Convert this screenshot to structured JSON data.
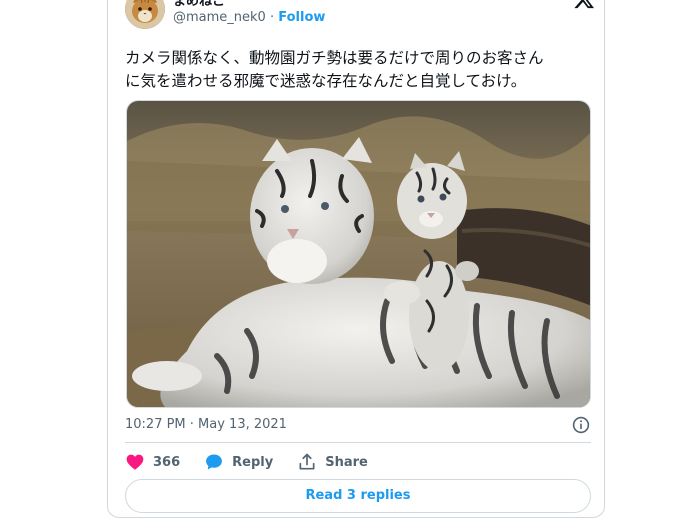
{
  "tweet": {
    "author": {
      "display_name": "まめねこ",
      "handle": "@mame_nek0",
      "separator": "·",
      "follow_label": "Follow",
      "avatar_icon": "cat-avatar"
    },
    "brand_icon": "x-logo-icon",
    "text_lines": [
      "カメラ関係なく、動物園ガチ勢は要るだけで周りのお客さん",
      "に気を遣わせる邪魔で迷惑な存在なんだと自覚しておけ。"
    ],
    "media": {
      "icon": "photo-white-tiger-with-cub"
    },
    "timestamp": "10:27 PM · May 13, 2021",
    "actions": {
      "like_count": "366",
      "reply_label": "Reply",
      "share_label": "Share"
    },
    "read_replies_label": "Read 3 replies",
    "colors": {
      "accent": "#1d9bf0",
      "like": "#f91880",
      "muted": "#536471",
      "border": "#cfd9de"
    }
  }
}
